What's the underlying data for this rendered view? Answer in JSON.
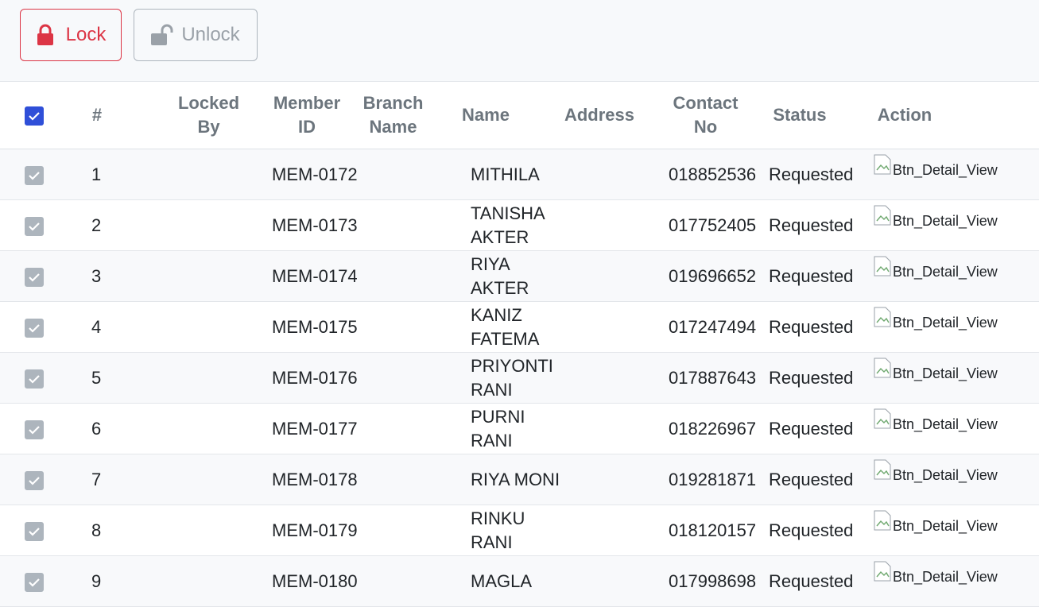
{
  "toolbar": {
    "lock_label": "Lock",
    "unlock_label": "Unlock"
  },
  "table": {
    "headers": {
      "index": "#",
      "locked_by": "Locked By",
      "member_id": "Member ID",
      "branch_name": "Branch Name",
      "name": "Name",
      "address": "Address",
      "contact_no": "Contact No",
      "status": "Status",
      "action": "Action"
    },
    "rows": [
      {
        "index": "1",
        "locked_by": "",
        "member_id": "MEM-0172",
        "branch_name": "",
        "name": "MITHILA",
        "address": "",
        "contact": "018852536",
        "status": "Requested",
        "action": "Btn_Detail_View"
      },
      {
        "index": "2",
        "locked_by": "",
        "member_id": "MEM-0173",
        "branch_name": "",
        "name": "TANISHA AKTER",
        "address": "",
        "contact": "017752405",
        "status": "Requested",
        "action": "Btn_Detail_View"
      },
      {
        "index": "3",
        "locked_by": "",
        "member_id": "MEM-0174",
        "branch_name": "",
        "name": "RIYA AKTER",
        "address": "",
        "contact": "019696652",
        "status": "Requested",
        "action": "Btn_Detail_View"
      },
      {
        "index": "4",
        "locked_by": "",
        "member_id": "MEM-0175",
        "branch_name": "",
        "name": "KANIZ FATEMA",
        "address": "",
        "contact": "017247494",
        "status": "Requested",
        "action": "Btn_Detail_View"
      },
      {
        "index": "5",
        "locked_by": "",
        "member_id": "MEM-0176",
        "branch_name": "",
        "name": "PRIYONTI RANI",
        "address": "",
        "contact": "017887643",
        "status": "Requested",
        "action": "Btn_Detail_View"
      },
      {
        "index": "6",
        "locked_by": "",
        "member_id": "MEM-0177",
        "branch_name": "",
        "name": "PURNI RANI",
        "address": "",
        "contact": "018226967",
        "status": "Requested",
        "action": "Btn_Detail_View"
      },
      {
        "index": "7",
        "locked_by": "",
        "member_id": "MEM-0178",
        "branch_name": "",
        "name": "RIYA MONI",
        "address": "",
        "contact": "019281871",
        "status": "Requested",
        "action": "Btn_Detail_View"
      },
      {
        "index": "8",
        "locked_by": "",
        "member_id": "MEM-0179",
        "branch_name": "",
        "name": "RINKU RANI",
        "address": "",
        "contact": "018120157",
        "status": "Requested",
        "action": "Btn_Detail_View"
      },
      {
        "index": "9",
        "locked_by": "",
        "member_id": "MEM-0180",
        "branch_name": "",
        "name": "MAGLA",
        "address": "",
        "contact": "017998698",
        "status": "Requested",
        "action": "Btn_Detail_View"
      }
    ]
  },
  "colors": {
    "lock": "#dc3545",
    "unlock": "#9aa1a8",
    "header_checkbox": "#2f4fd8",
    "row_checkbox": "#adb5bd"
  },
  "icons": {
    "lock": "lock-icon",
    "unlock": "unlock-icon",
    "checkbox": "checkmark-icon",
    "broken_image": "broken-image-icon"
  }
}
